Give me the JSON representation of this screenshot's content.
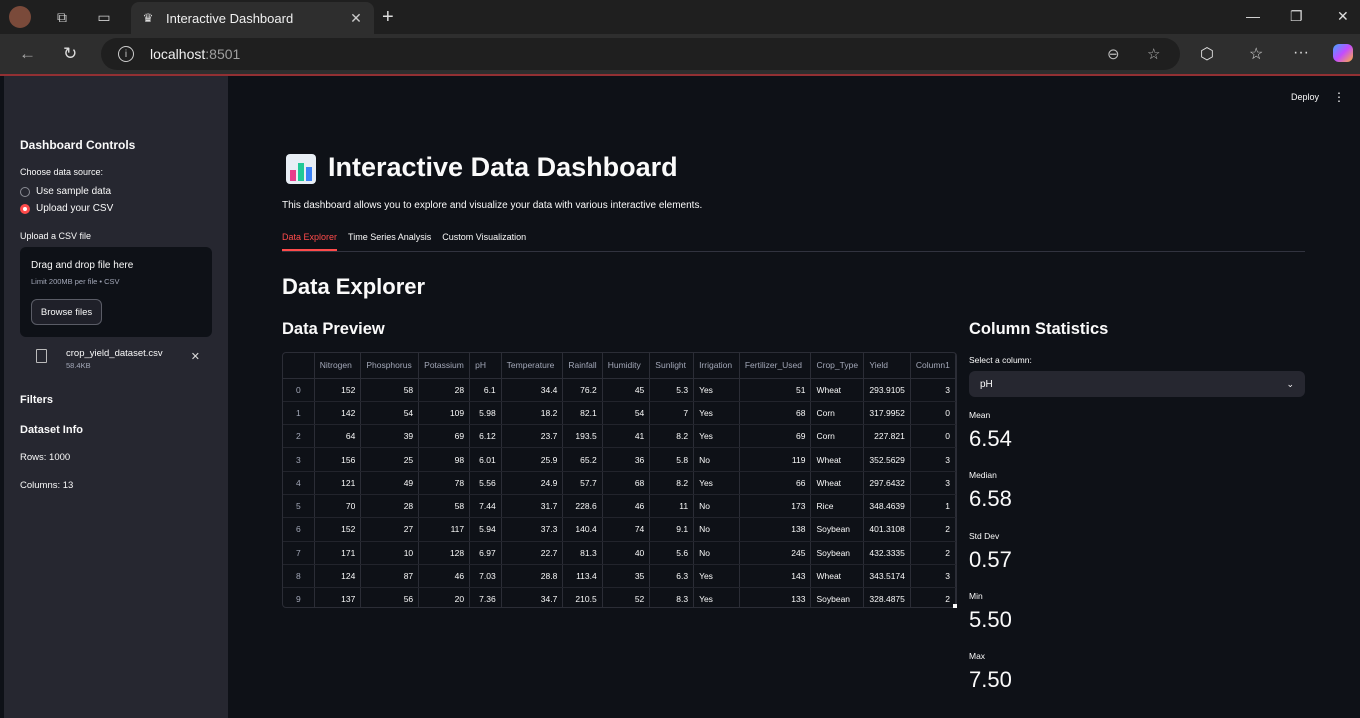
{
  "browser": {
    "tab_title": "Interactive Dashboard",
    "url_host": "localhost",
    "url_port": ":8501"
  },
  "sidebar": {
    "title": "Dashboard Controls",
    "source_label": "Choose data source:",
    "options": [
      "Use sample data",
      "Upload your CSV"
    ],
    "selected_option": "Upload your CSV",
    "upload_label": "Upload a CSV file",
    "dropzone_text": "Drag and drop file here",
    "dropzone_limit": "Limit 200MB per file • CSV",
    "browse_label": "Browse files",
    "file_name": "crop_yield_dataset.csv",
    "file_size": "58.4KB",
    "filters_title": "Filters",
    "dataset_info_title": "Dataset Info",
    "rows_text": "Rows: 1000",
    "columns_text": "Columns: 13"
  },
  "header": {
    "deploy_label": "Deploy"
  },
  "main": {
    "title": "Interactive Data Dashboard",
    "description": "This dashboard allows you to explore and visualize your data with various interactive elements.",
    "tabs": [
      "Data Explorer",
      "Time Series Analysis",
      "Custom Visualization"
    ],
    "active_tab": "Data Explorer",
    "section_title": "Data Explorer",
    "preview_title": "Data Preview",
    "stats_title": "Column Statistics"
  },
  "table": {
    "columns": [
      "",
      "Nitrogen",
      "Phosphorus",
      "Potassium",
      "pH",
      "Temperature",
      "Rainfall",
      "Humidity",
      "Sunlight",
      "Irrigation",
      "Fertilizer_Used",
      "Crop_Type",
      "Yield",
      "Column1"
    ],
    "rows": [
      [
        "0",
        "152",
        "58",
        "28",
        "6.1",
        "34.4",
        "76.2",
        "45",
        "5.3",
        "Yes",
        "51",
        "Wheat",
        "293.9105",
        "3"
      ],
      [
        "1",
        "142",
        "54",
        "109",
        "5.98",
        "18.2",
        "82.1",
        "54",
        "7",
        "Yes",
        "68",
        "Corn",
        "317.9952",
        "0"
      ],
      [
        "2",
        "64",
        "39",
        "69",
        "6.12",
        "23.7",
        "193.5",
        "41",
        "8.2",
        "Yes",
        "69",
        "Corn",
        "227.821",
        "0"
      ],
      [
        "3",
        "156",
        "25",
        "98",
        "6.01",
        "25.9",
        "65.2",
        "36",
        "5.8",
        "No",
        "119",
        "Wheat",
        "352.5629",
        "3"
      ],
      [
        "4",
        "121",
        "49",
        "78",
        "5.56",
        "24.9",
        "57.7",
        "68",
        "8.2",
        "Yes",
        "66",
        "Wheat",
        "297.6432",
        "3"
      ],
      [
        "5",
        "70",
        "28",
        "58",
        "7.44",
        "31.7",
        "228.6",
        "46",
        "11",
        "No",
        "173",
        "Rice",
        "348.4639",
        "1"
      ],
      [
        "6",
        "152",
        "27",
        "117",
        "5.94",
        "37.3",
        "140.4",
        "74",
        "9.1",
        "No",
        "138",
        "Soybean",
        "401.3108",
        "2"
      ],
      [
        "7",
        "171",
        "10",
        "128",
        "6.97",
        "22.7",
        "81.3",
        "40",
        "5.6",
        "No",
        "245",
        "Soybean",
        "432.3335",
        "2"
      ],
      [
        "8",
        "124",
        "87",
        "46",
        "7.03",
        "28.8",
        "113.4",
        "35",
        "6.3",
        "Yes",
        "143",
        "Wheat",
        "343.5174",
        "3"
      ],
      [
        "9",
        "137",
        "56",
        "20",
        "7.36",
        "34.7",
        "210.5",
        "52",
        "8.3",
        "Yes",
        "133",
        "Soybean",
        "328.4875",
        "2"
      ]
    ]
  },
  "stats": {
    "select_label": "Select a column:",
    "selected_column": "pH",
    "metrics": [
      {
        "label": "Mean",
        "value": "6.54"
      },
      {
        "label": "Median",
        "value": "6.58"
      },
      {
        "label": "Std Dev",
        "value": "0.57"
      },
      {
        "label": "Min",
        "value": "5.50"
      },
      {
        "label": "Max",
        "value": "7.50"
      }
    ]
  },
  "colors": {
    "accent": "#ff4b4b",
    "sidebar_bg": "#262730",
    "main_bg": "#0e1117"
  }
}
